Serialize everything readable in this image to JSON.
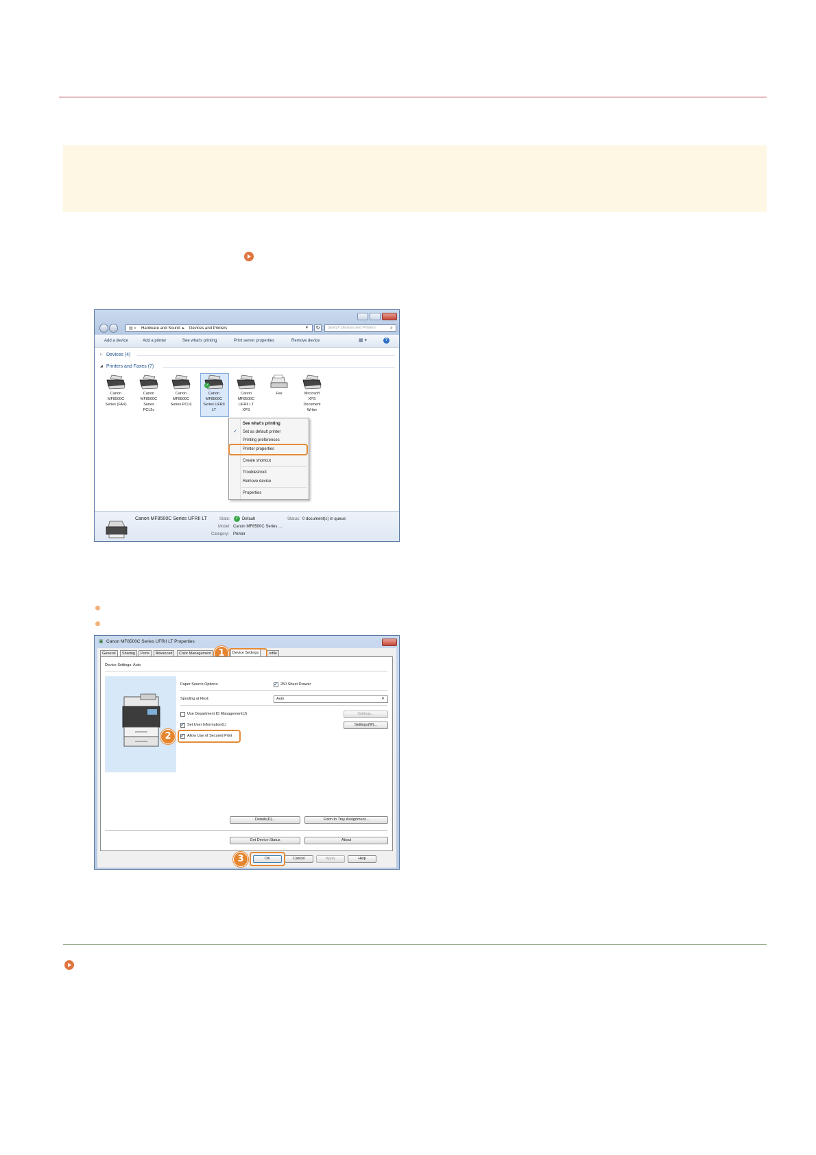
{
  "screenshot1": {
    "address_path": [
      "Hardware and Sound",
      "Devices and Printers"
    ],
    "search_placeholder": "Search Devices and Printers",
    "toolbar": [
      "Add a device",
      "Add a printer",
      "See what's printing",
      "Print server properties",
      "Remove device"
    ],
    "devices_group": "Devices (4)",
    "printers_group": "Printers and Faxes (7)",
    "printers": [
      {
        "label": "Canon MF8500C Series (FAX)"
      },
      {
        "label": "Canon MF8500C Series PCL5c"
      },
      {
        "label": "Canon MF8500C Series PCL6"
      },
      {
        "label": "Canon MF8500C Series UFRII LT"
      },
      {
        "label": "Canon MF8500C UFRII LT XPS"
      },
      {
        "label": "Fax"
      },
      {
        "label": "Microsoft XPS Document Writer"
      }
    ],
    "context_menu": {
      "see_printing": "See what's printing",
      "set_default": "Set as default printer",
      "printing_prefs": "Printing preferences",
      "printer_props": "Printer properties",
      "create_shortcut": "Create shortcut",
      "troubleshoot": "Troubleshoot",
      "remove_device": "Remove device",
      "properties": "Properties"
    },
    "details": {
      "name": "Canon MF8500C Series UFRII LT",
      "state_label": "State:",
      "state_value": "Default",
      "status_label": "Status:",
      "status_value": "0 document(s) in queue",
      "model_label": "Model:",
      "model_value": "Canon MF8500C Series ...",
      "category_label": "Category:",
      "category_value": "Printer"
    }
  },
  "screenshot2": {
    "title": "Canon MF8500C Series UFRII LT Properties",
    "tabs": [
      "General",
      "Sharing",
      "Ports",
      "Advanced",
      "Color Management",
      "Device Settings",
      "rofile"
    ],
    "section_label": "Device Settings: Auto",
    "paper_source_label": "Paper Source Options:",
    "paper_source_value": "250 Sheet Drawer",
    "spooling_label": "Spooling at Host:",
    "spooling_value": "Auto",
    "dept_id_label": "Use Department ID Management(J)",
    "settings_btn": "Settings...",
    "user_info_label": "Set User Information(L)",
    "settings_w_btn": "Settings(W)...",
    "secured_print_label": "Allow Use of Secured Print",
    "details_btn": "Details(D)...",
    "form_tray_btn": "Form to Tray Assignment...",
    "get_status_btn": "Get Device Status",
    "about_btn": "About",
    "ok_btn": "OK",
    "cancel_btn": "Cancel",
    "apply_btn": "Apply",
    "help_btn": "Help",
    "callouts": [
      "1",
      "2",
      "3"
    ]
  }
}
